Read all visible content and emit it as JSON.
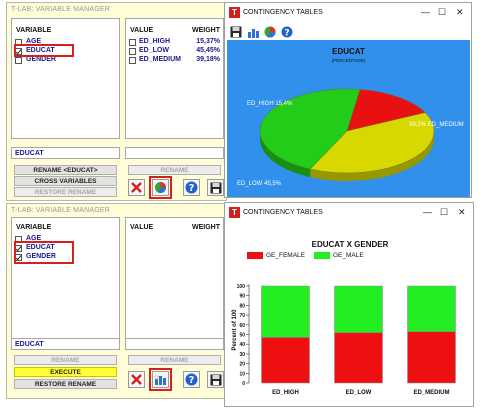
{
  "vm1": {
    "title": "T-LAB: VARIABLE MANAGER",
    "variable_header": "VARIABLE",
    "variables": [
      {
        "label": "AGE",
        "checked": false
      },
      {
        "label": "EDUCAT",
        "checked": true
      },
      {
        "label": "GENDER",
        "checked": false
      }
    ],
    "value_header": "VALUE",
    "weight_header": "WEIGHT",
    "values": [
      {
        "label": "ED_HIGH",
        "weight": "15,37%"
      },
      {
        "label": "ED_LOW",
        "weight": "45,45%"
      },
      {
        "label": "ED_MEDIUM",
        "weight": "39,18%"
      }
    ],
    "selected_field": "EDUCAT",
    "buttons": {
      "rename_var": "RENAME <EDUCAT>",
      "rename": "RENAME",
      "cross_variables": "CROSS VARIABLES",
      "restore_rename": "RESTORE RENAME"
    }
  },
  "vm2": {
    "title": "T-LAB: VARIABLE MANAGER",
    "variable_header": "VARIABLE",
    "variables": [
      {
        "label": "AGE",
        "checked": false
      },
      {
        "label": "EDUCAT",
        "checked": true
      },
      {
        "label": "GENDER",
        "checked": true
      }
    ],
    "value_header": "VALUE",
    "weight_header": "WEIGHT",
    "selected_field": "EDUCAT",
    "buttons": {
      "rename_left": "RENAME",
      "rename_right": "RENAME",
      "execute": "EXECUTE",
      "restore_rename": "RESTORE RENAME"
    }
  },
  "ct1": {
    "title": "CONTINGENCY TABLES",
    "logo": "T",
    "chart_data": {
      "type": "pie",
      "title": "EDUCAT",
      "subtitle": "(PERCENTAGE)",
      "slices": [
        {
          "label": "ED_HIGH",
          "value": 15.4,
          "color": "#e81010"
        },
        {
          "label": "ED_MEDIUM",
          "value": 39.2,
          "color": "#d8d800"
        },
        {
          "label": "ED_LOW",
          "value": 45.5,
          "color": "#22cc18"
        }
      ],
      "slice_labels": [
        "ED_HIGH  15,4%",
        "39,2%  ED_MEDIUM",
        "ED_LOW  45,5%"
      ],
      "background": "#3090ec"
    }
  },
  "ct2": {
    "title": "CONTINGENCY TABLES",
    "logo": "T",
    "chart_data": {
      "type": "bar",
      "stacked": true,
      "title": "EDUCAT X GENDER",
      "categories": [
        "ED_HIGH",
        "ED_LOW",
        "ED_MEDIUM"
      ],
      "series": [
        {
          "name": "GE_FEMALE",
          "color": "#ee1010",
          "values": [
            47,
            52,
            53
          ]
        },
        {
          "name": "GE_MALE",
          "color": "#22ee22",
          "values": [
            53,
            48,
            47
          ]
        }
      ],
      "ylabel": "Percent of 100",
      "ylim": [
        0,
        100
      ],
      "yticks": [
        "0",
        "10",
        "20",
        "30",
        "40",
        "50",
        "60",
        "70",
        "80",
        "90",
        "100"
      ]
    }
  }
}
